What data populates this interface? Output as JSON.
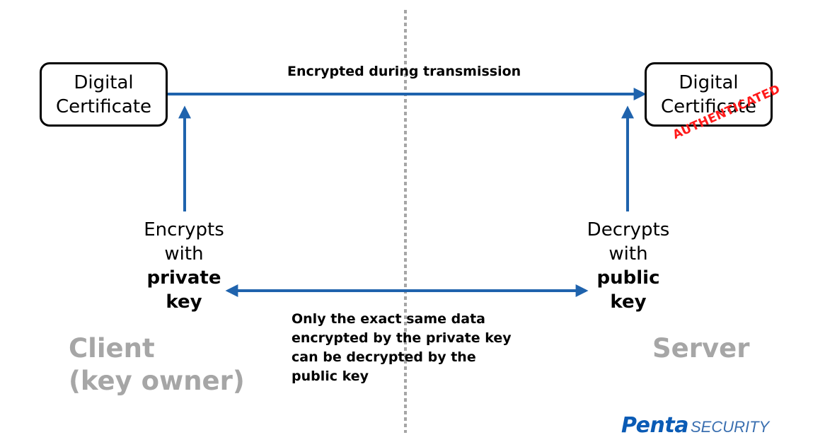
{
  "colors": {
    "arrow": "#1f63ad",
    "divider": "#a6a6a6",
    "side_label": "#a6a6a6",
    "stamp": "#ff1a1a",
    "logo": "#0a5bb5"
  },
  "left_certificate": {
    "line1": "Digital",
    "line2": "Certificate"
  },
  "right_certificate": {
    "line1": "Digital",
    "line2": "Certificate"
  },
  "transmission_label": "Encrypted during transmission",
  "stamp_text": "AUTHENTICATED",
  "client_operation": {
    "line1": "Encrypts",
    "line2": "with",
    "line3": "private",
    "line4": "key"
  },
  "server_operation": {
    "line1": "Decrypts",
    "line2": "with",
    "line3": "public",
    "line4": "key"
  },
  "note": {
    "line1": "Only the exact same data",
    "line2": "encrypted by the private key",
    "line3": "can be decrypted by the",
    "line4": "public key"
  },
  "client_label": {
    "line1": "Client",
    "line2": "(key owner)"
  },
  "server_label": "Server",
  "logo": {
    "brand": "Penta",
    "suffix": "SECURITY"
  }
}
